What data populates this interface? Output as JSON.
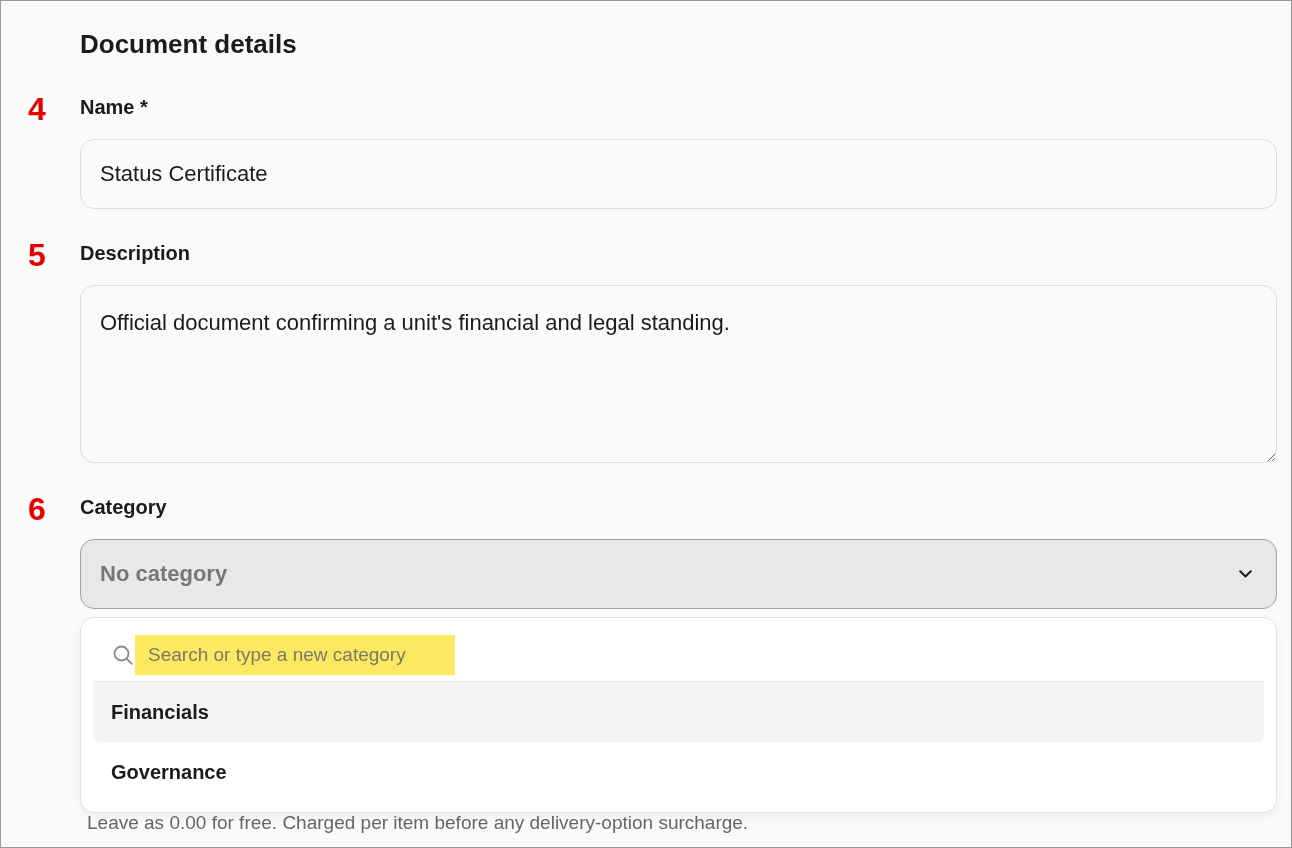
{
  "section_title": "Document details",
  "fields": [
    {
      "kind": "text",
      "marker": "4",
      "label": "Name *",
      "value": "Status Certificate"
    },
    {
      "kind": "textarea",
      "marker": "5",
      "label": "Description",
      "value": "Official document confirming a unit's financial and legal standing."
    },
    {
      "kind": "select",
      "marker": "6",
      "label": "Category",
      "placeholder": "No category",
      "expanded": true,
      "dropdown": {
        "search": {
          "placeholder": "Search or type a new category",
          "highlighted": true
        },
        "options": [
          {
            "label": "Financials",
            "highlighted": true
          },
          {
            "label": "Governance",
            "highlighted": false
          }
        ]
      }
    }
  ],
  "hint": "Leave as 0.00 for free. Charged per item before any delivery-option surcharge."
}
